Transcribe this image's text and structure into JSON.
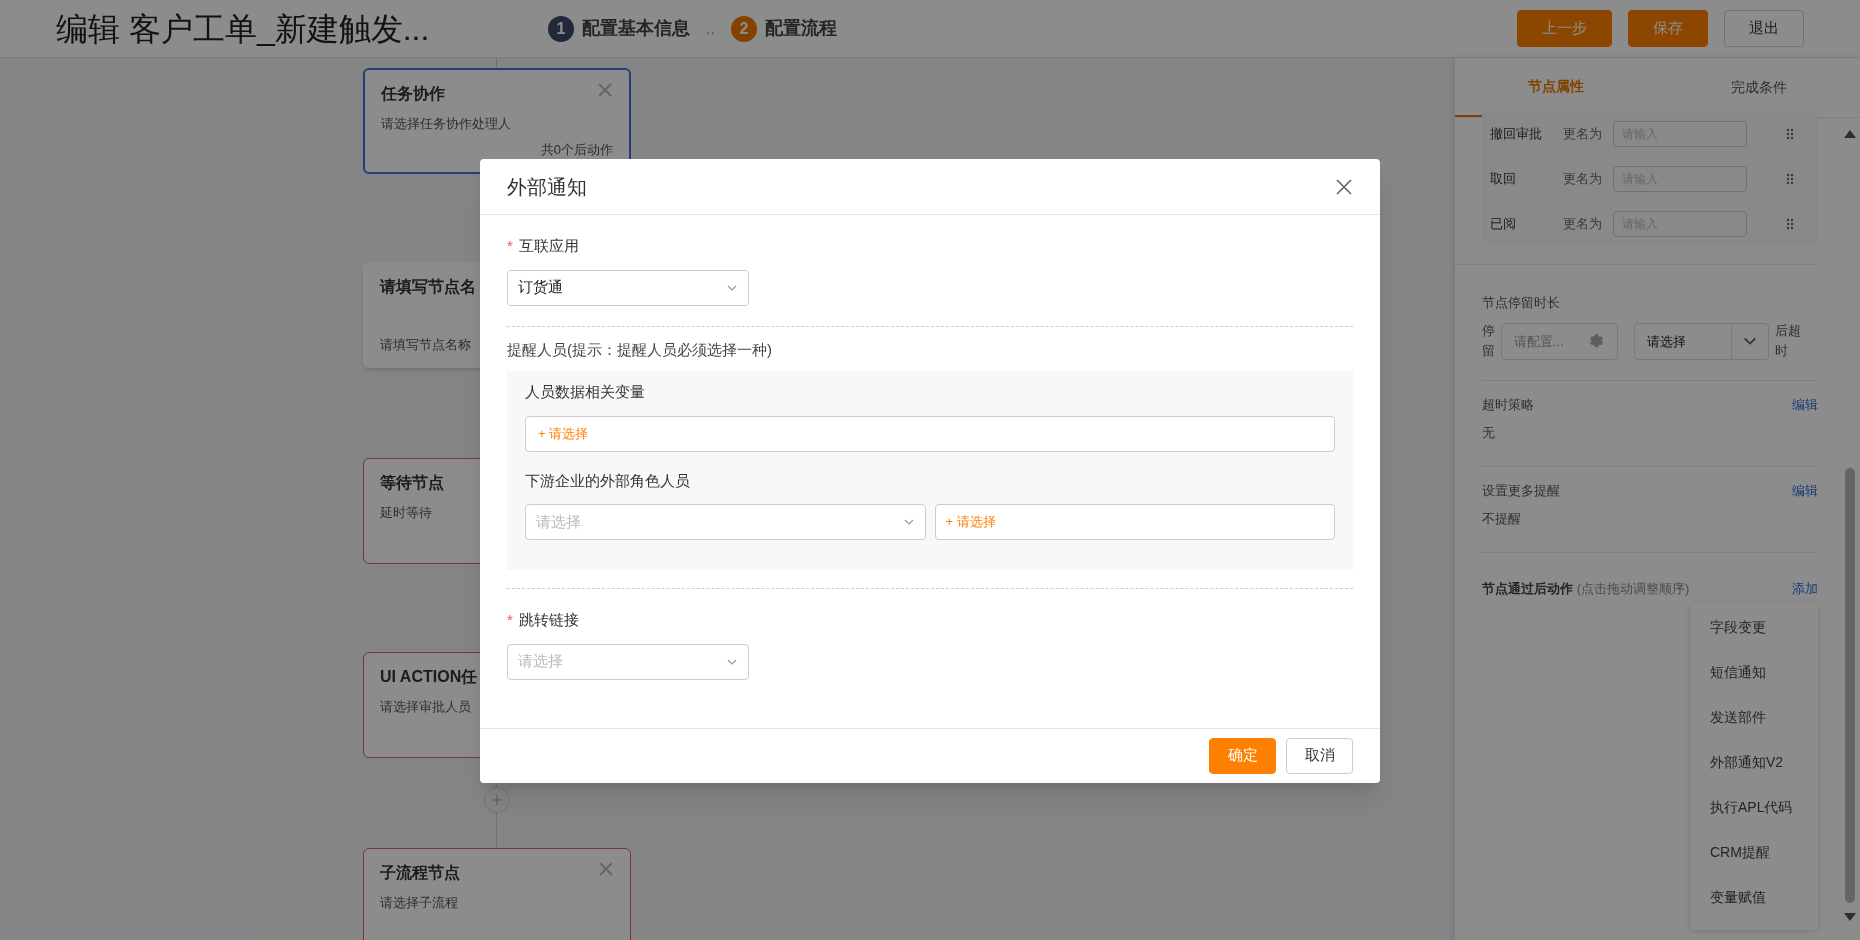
{
  "header": {
    "title": "编辑 客户工单_新建触发...",
    "steps": [
      {
        "number": "1",
        "label": "配置基本信息",
        "selected": false
      },
      {
        "number": "2",
        "label": "配置流程",
        "selected": true
      }
    ],
    "step_separator": "..",
    "buttons": [
      {
        "label": "上一步",
        "kind": "primary"
      },
      {
        "label": "保存",
        "kind": "primary"
      },
      {
        "label": "退出",
        "kind": "default"
      }
    ]
  },
  "canvas": {
    "nodes": [
      {
        "title": "任务协作",
        "subtitle": "请选择任务协作处理人",
        "footer": "共0个后动作",
        "selected": true,
        "closable": true
      },
      {
        "title": "请填写节点名",
        "subtitle": "请填写节点名称",
        "selected": false,
        "error": false
      },
      {
        "title": "等待节点",
        "subtitle": "延时等待",
        "selected": false,
        "error": true,
        "closable": false
      },
      {
        "title": "UI ACTION任",
        "subtitle": "请选择审批人员",
        "selected": false,
        "error": true,
        "closable": false
      },
      {
        "title": "子流程节点",
        "subtitle": "请选择子流程",
        "selected": false,
        "error": true,
        "closable": true
      }
    ]
  },
  "right_panel": {
    "tabs": [
      {
        "label": "节点属性",
        "selected": true
      },
      {
        "label": "完成条件",
        "selected": false
      }
    ],
    "rename_rows": [
      {
        "label": "撤回审批",
        "rename_label": "更名为",
        "placeholder": "请输入"
      },
      {
        "label": "取回",
        "rename_label": "更名为",
        "placeholder": "请输入"
      },
      {
        "label": "已阅",
        "rename_label": "更名为",
        "placeholder": "请输入"
      }
    ],
    "stay_duration": {
      "title": "节点停留时长",
      "side_label": "停留",
      "input_placeholder": "请配置...",
      "select_value": "请选择",
      "suffix": "后超时"
    },
    "sections": [
      {
        "title": "超时策略",
        "link": "编辑",
        "value": "无"
      },
      {
        "title": "设置更多提醒",
        "link": "编辑",
        "value": "不提醒"
      }
    ],
    "post_actions": {
      "title": "节点通过后动作",
      "hint": "(点击拖动调整顺序)",
      "link": "添加",
      "menu": [
        "字段变更",
        "短信通知",
        "发送部件",
        "外部通知V2",
        "执行APL代码",
        "CRM提醒",
        "变量赋值"
      ]
    }
  },
  "modal": {
    "title": "外部通知",
    "app_field": {
      "marker": "*",
      "label": "互联应用",
      "value": "订货通"
    },
    "recipients": {
      "label": "提醒人员(提示：提醒人员必须选择一种)",
      "variable_label": "人员数据相关变量",
      "variable_picker": "+ 请选择",
      "role_label": "下游企业的外部角色人员",
      "role_select_placeholder": "请选择",
      "role_picker": "+ 请选择"
    },
    "link_field": {
      "marker": "*",
      "label": "跳转链接",
      "placeholder": "请选择"
    },
    "buttons": [
      {
        "label": "确定",
        "kind": "primary"
      },
      {
        "label": "取消",
        "kind": "default"
      }
    ]
  }
}
